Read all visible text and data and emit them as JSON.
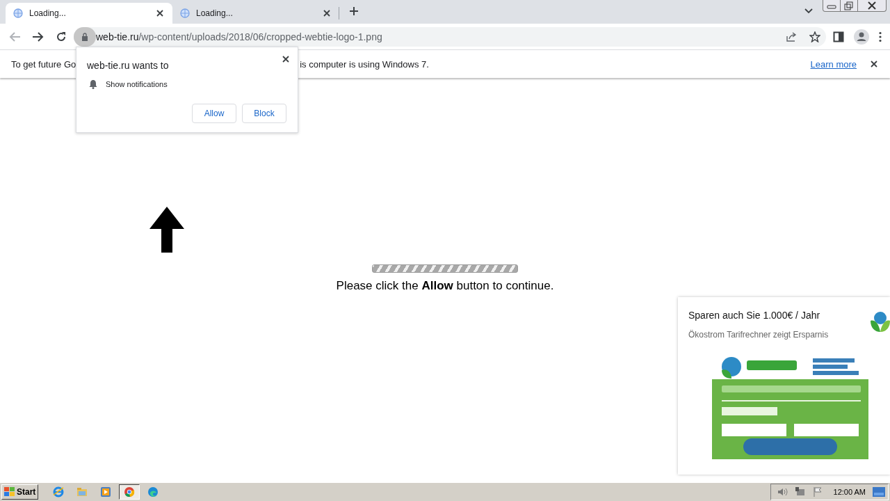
{
  "tabs": [
    {
      "title": "Loading...",
      "selected": true
    },
    {
      "title": "Loading...",
      "selected": false
    }
  ],
  "address": {
    "host": "web-tie.ru",
    "path": "/wp-content/uploads/2018/06/cropped-webtie-logo-1.png"
  },
  "infobar": {
    "text_before": "To get future Go",
    "text_after": "is computer is using Windows 7.",
    "link": "Learn more"
  },
  "permission_popup": {
    "title": "web-tie.ru wants to",
    "permission": "Show notifications",
    "buttons": [
      "Allow",
      "Block"
    ]
  },
  "page": {
    "message": "Please click the **Allow** button to continue."
  },
  "ad": {
    "title": "Sparen auch Sie 1.000€ / Jahr",
    "subtitle": "Ökostrom Tarifrechner zeigt Ersparnis"
  },
  "taskbar": {
    "start": "Start",
    "clock": "12:00 AM",
    "apps": [
      {
        "selected": false
      },
      {
        "selected": false
      },
      {
        "selected": false
      },
      {
        "selected": true
      },
      {
        "selected": false
      }
    ]
  }
}
